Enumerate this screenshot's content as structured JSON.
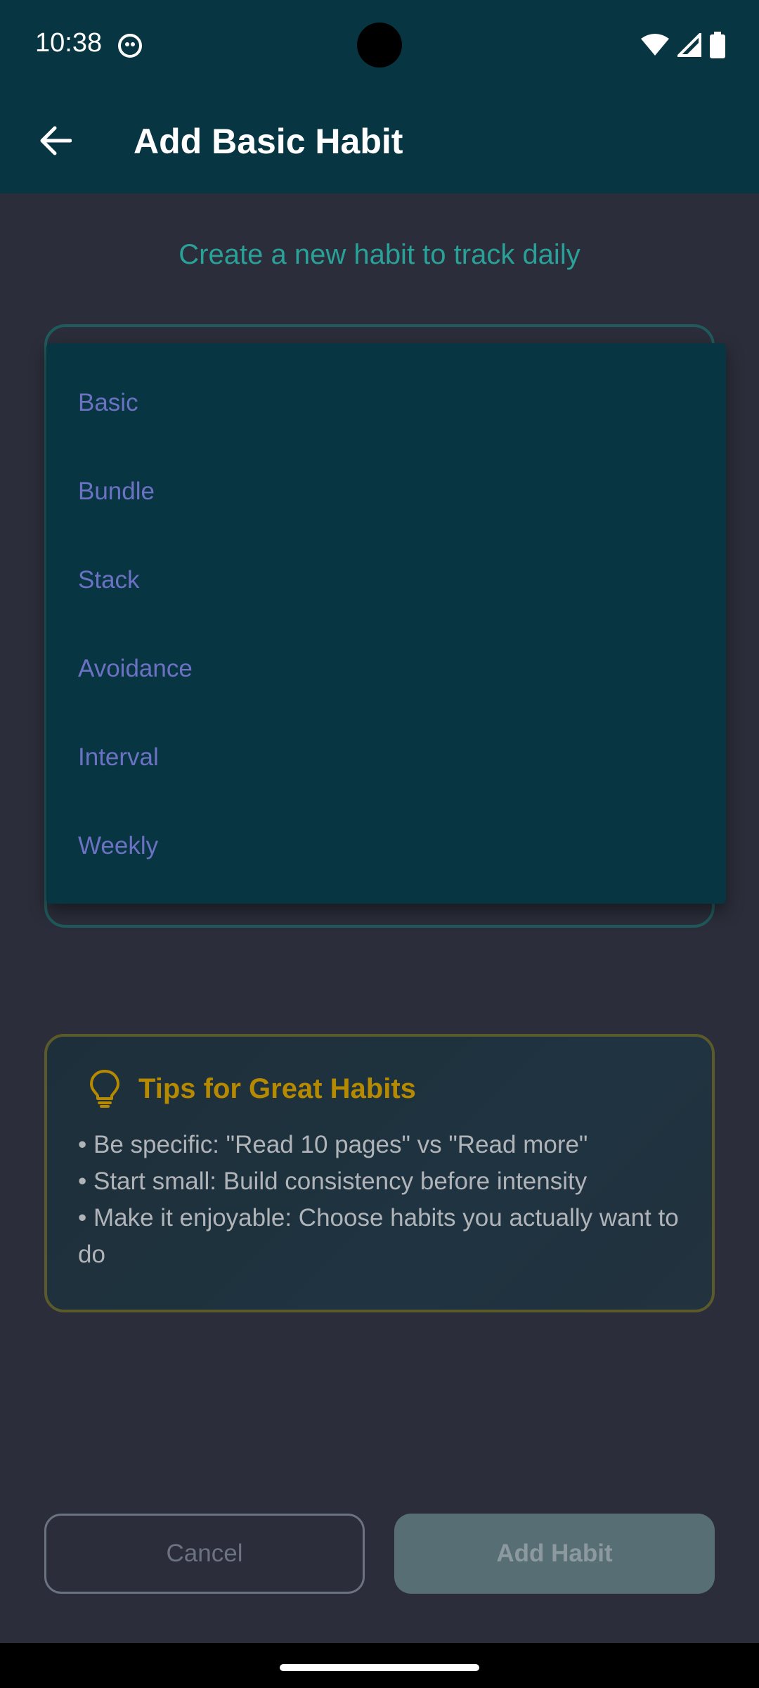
{
  "status_bar": {
    "time": "10:38",
    "icons": [
      "app-notification-icon",
      "wifi-icon",
      "signal-icon",
      "battery-icon"
    ]
  },
  "app_bar": {
    "title": "Add Basic Habit",
    "back_icon": "arrow-back-icon"
  },
  "subtitle": "Create a new habit to track daily",
  "dropdown": {
    "items": [
      "Basic",
      "Bundle",
      "Stack",
      "Avoidance",
      "Interval",
      "Weekly"
    ]
  },
  "tips": {
    "title": "Tips for Great Habits",
    "icon": "lightbulb-icon",
    "lines": [
      "• Be specific: \"Read 10 pages\" vs \"Read more\"",
      "• Start small: Build consistency before intensity",
      "• Make it enjoyable: Choose habits you actually want to do"
    ]
  },
  "buttons": {
    "cancel_label": "Cancel",
    "add_label": "Add Habit"
  },
  "colors": {
    "app_bar_bg": "#073642",
    "screen_bg": "#2b2d3a",
    "accent_teal": "#2aa198",
    "menu_text": "#6c71c4",
    "tips_accent": "#b58900",
    "add_button_bg": "#586e75"
  }
}
